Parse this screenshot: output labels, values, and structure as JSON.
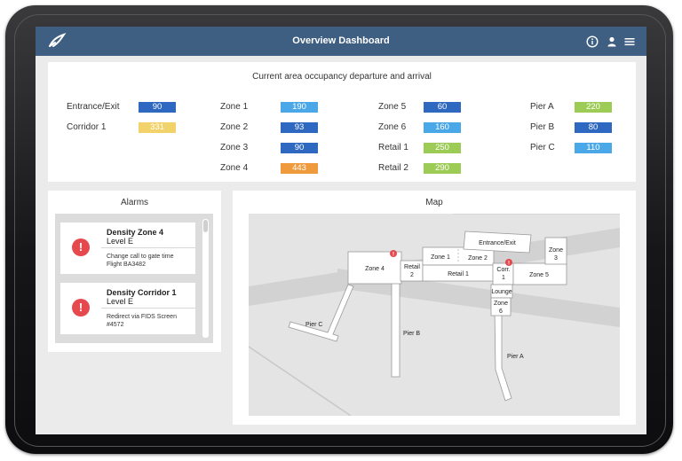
{
  "header": {
    "title": "Overview Dashboard"
  },
  "occupancy": {
    "title": "Current area occupancy departure and arrival",
    "columns": [
      [
        {
          "label": "Entrance/Exit",
          "value": "90",
          "color": "#2f68c0"
        },
        {
          "label": "Corridor 1",
          "value": "331",
          "color": "#f2d36b"
        }
      ],
      [
        {
          "label": "Zone 1",
          "value": "190",
          "color": "#4aa8e8"
        },
        {
          "label": "Zone 2",
          "value": "93",
          "color": "#2f68c0"
        },
        {
          "label": "Zone 3",
          "value": "90",
          "color": "#2f68c0"
        },
        {
          "label": "Zone 4",
          "value": "443",
          "color": "#ef9a3c"
        }
      ],
      [
        {
          "label": "Zone 5",
          "value": "60",
          "color": "#2f68c0"
        },
        {
          "label": "Zone 6",
          "value": "160",
          "color": "#4aa8e8"
        },
        {
          "label": "Retail 1",
          "value": "250",
          "color": "#9ccc55"
        },
        {
          "label": "Retail 2",
          "value": "290",
          "color": "#9ccc55"
        }
      ],
      [
        {
          "label": "Pier A",
          "value": "220",
          "color": "#9ccc55"
        },
        {
          "label": "Pier B",
          "value": "80",
          "color": "#2f68c0"
        },
        {
          "label": "Pier C",
          "value": "110",
          "color": "#4aa8e8"
        }
      ]
    ]
  },
  "alarms": {
    "title": "Alarms",
    "items": [
      {
        "title": "Density Zone 4",
        "level": "Level E",
        "line1": "Change call to gate time",
        "line2": "Flight BA3482"
      },
      {
        "title": "Density Corridor 1",
        "level": "Level E",
        "line1": "Redirect via FIDS Screen",
        "line2": "#4572"
      }
    ]
  },
  "map": {
    "title": "Map",
    "labels": {
      "entrance": "Entrance/Exit",
      "zone1": "Zone 1",
      "zone2": "Zone 2",
      "zone3a": "Zone",
      "zone3b": "3",
      "zone4": "Zone 4",
      "zone5": "Zone 5",
      "zone6a": "Zone",
      "zone6b": "6",
      "retail1": "Retail 1",
      "retail2a": "Retail",
      "retail2b": "2",
      "corr_a": "Corr.",
      "corr_b": "1",
      "lounge": "Lounge",
      "pierA": "Pier A",
      "pierB": "Pier B",
      "pierC": "Pier C"
    },
    "alert_mark": "!"
  },
  "colors": {
    "header": "#3f5f82",
    "alert": "#e5484d"
  },
  "icons": [
    "app-logo-icon",
    "info-icon",
    "user-icon",
    "menu-icon",
    "alert-icon"
  ]
}
